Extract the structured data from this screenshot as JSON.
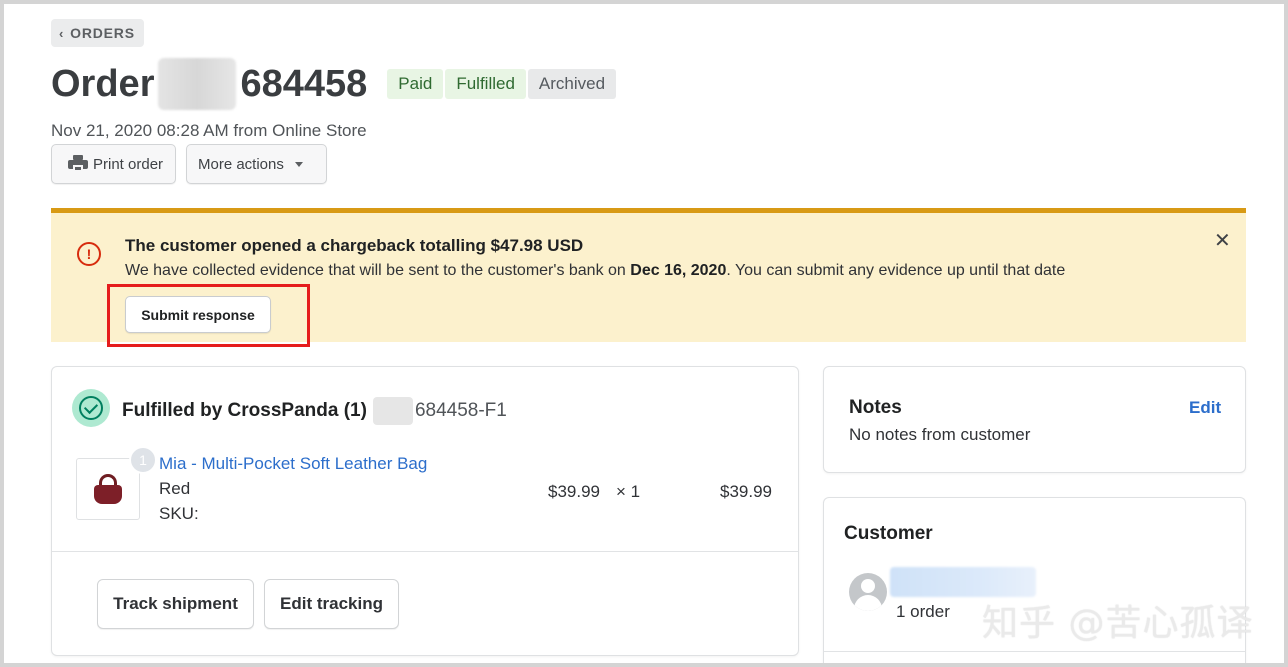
{
  "header": {
    "back_label": "ORDERS",
    "order_prefix": "Order",
    "order_suffix": "684458",
    "badges": [
      "Paid",
      "Fulfilled",
      "Archived"
    ],
    "subtitle": "Nov 21, 2020 08:28 AM from Online Store",
    "print_label": "Print order",
    "more_label": "More actions"
  },
  "banner": {
    "title": "The customer opened a chargeback totalling $47.98 USD",
    "text_before": "We have collected evidence that will be sent to the customer's bank on ",
    "date": "Dec 16, 2020",
    "text_after": ". You can submit any evidence up until that date",
    "submit_label": "Submit response",
    "alert_glyph": "!",
    "close_glyph": "✕"
  },
  "fulfillment": {
    "title": "Fulfilled by CrossPanda (1)",
    "fulfillment_id": "684458-F1",
    "item": {
      "quantity_badge": "1",
      "name": "Mia - Multi-Pocket Soft Leather Bag",
      "variant": "Red",
      "sku": "SKU:",
      "unit_price": "$39.99",
      "times": "× 1",
      "total": "$39.99"
    },
    "track_label": "Track shipment",
    "edit_tracking_label": "Edit tracking"
  },
  "notes": {
    "title": "Notes",
    "edit_label": "Edit",
    "text": "No notes from customer"
  },
  "customer": {
    "title": "Customer",
    "order_count": "1 order"
  },
  "watermark": "知乎 @苦心孤译",
  "colors": {
    "banner_bg": "#fcf1cd",
    "banner_border": "#d89a15",
    "link": "#2c6ecb",
    "highlight": "#e51c1c",
    "success": "#007f5f"
  }
}
